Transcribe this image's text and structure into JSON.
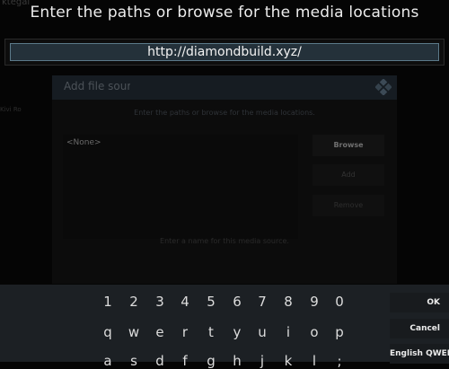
{
  "background": {
    "top_left_label": "ktegal",
    "left_label": "Kivi Ro",
    "dialog": {
      "title": "Add file source",
      "subtitle": "Enter the paths or browse for the media locations.",
      "path_item": "<None>",
      "buttons": {
        "browse": "Browse",
        "add": "Add",
        "remove": "Remove"
      },
      "name_hint": "Enter a name for this media source."
    }
  },
  "keyboard": {
    "heading": "Enter the paths or browse for the media locations",
    "input_value": "http://diamondbuild.xyz/",
    "rows": [
      [
        "1",
        "2",
        "3",
        "4",
        "5",
        "6",
        "7",
        "8",
        "9",
        "0"
      ],
      [
        "q",
        "w",
        "e",
        "r",
        "t",
        "y",
        "u",
        "i",
        "o",
        "p"
      ],
      [
        "a",
        "s",
        "d",
        "f",
        "g",
        "h",
        "j",
        "k",
        "l",
        ";"
      ]
    ],
    "buttons": {
      "ok": "OK",
      "cancel": "Cancel",
      "layout": "English QWERTY"
    }
  }
}
